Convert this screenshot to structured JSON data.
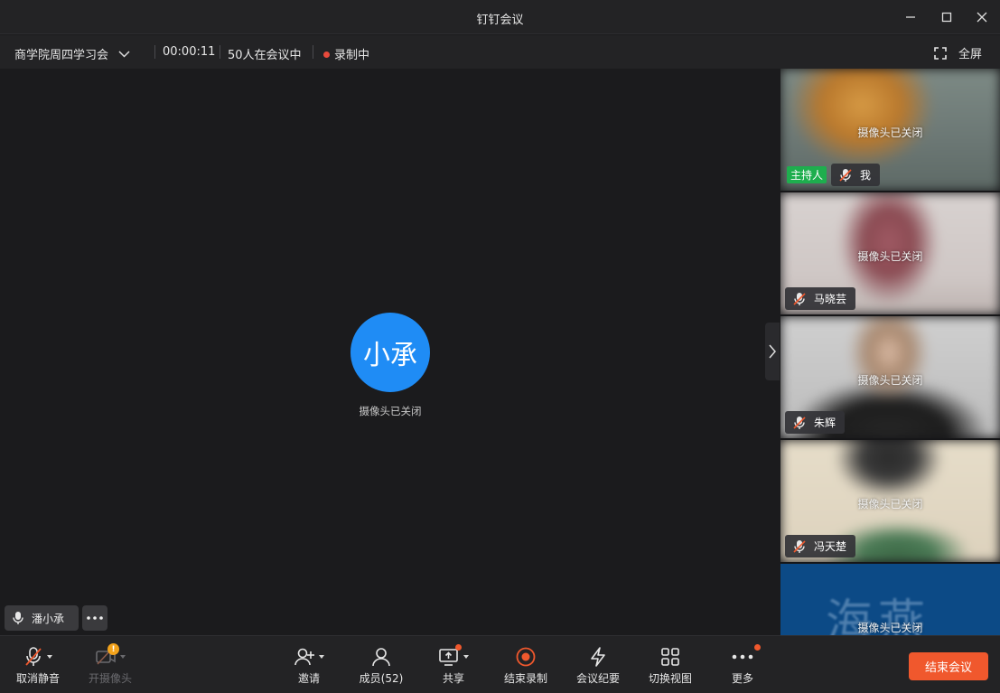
{
  "window": {
    "title": "钉钉会议"
  },
  "infobar": {
    "meeting_name": "商学院周四学习会",
    "elapsed": "00:00:11",
    "participants_status": "50人在会议中",
    "recording_status": "录制中",
    "fullscreen_label": "全屏"
  },
  "stage": {
    "avatar_text": "小承",
    "camera_off_text": "摄像头已关闭",
    "speaker_name": "潘小承"
  },
  "side_tiles": [
    {
      "name": "我",
      "camera_off_text": "摄像头已关闭",
      "badge": "主持人"
    },
    {
      "name": "马晓芸",
      "camera_off_text": "摄像头已关闭"
    },
    {
      "name": "朱辉",
      "camera_off_text": "摄像头已关闭"
    },
    {
      "name": "冯天楚",
      "camera_off_text": "摄像头已关闭"
    },
    {
      "name": "",
      "camera_off_text": "摄像头已关闭",
      "bg_text": "海燕"
    }
  ],
  "toolbar": {
    "unmute": "取消静音",
    "camera": "开摄像头",
    "invite": "邀请",
    "members": "成员(52)",
    "share": "共享",
    "stop_record": "结束录制",
    "minutes": "会议纪要",
    "switch_view": "切换视图",
    "more": "更多",
    "end_meeting": "结束会议"
  },
  "colors": {
    "accent_blue": "#1f8cf5",
    "host_green": "#1eae4e",
    "danger_orange": "#f0582d",
    "record_red": "#e94a3c"
  }
}
